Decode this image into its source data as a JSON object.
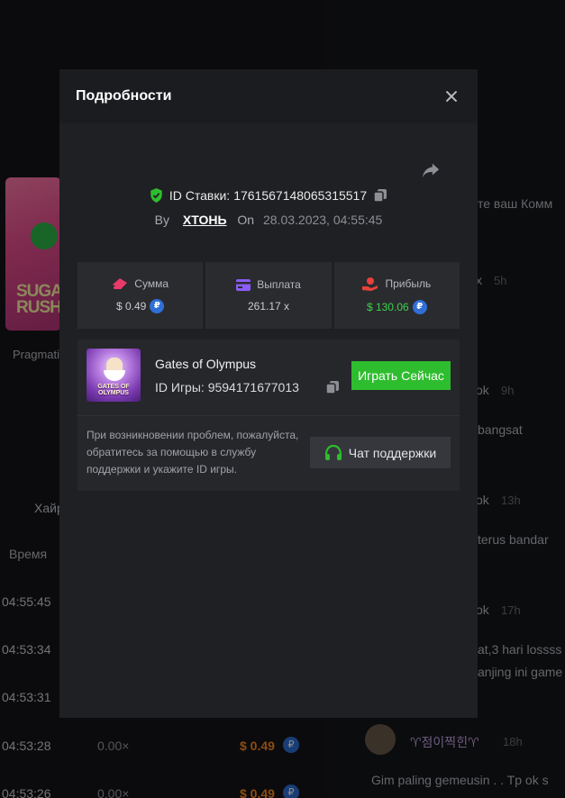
{
  "background": {
    "game_card_title": "SUGAR RUSH",
    "provider": "Pragmatic",
    "tab_label": "Хайроллеры",
    "time_header": "Время",
    "rows": [
      {
        "time": "04:55:45",
        "multiplier": "",
        "amount": ""
      },
      {
        "time": "04:53:34",
        "multiplier": "",
        "amount": ""
      },
      {
        "time": "04:53:31",
        "multiplier": "",
        "amount": ""
      },
      {
        "time": "04:53:28",
        "multiplier": "0.00×",
        "amount": "$ 0.49"
      },
      {
        "time": "04:53:26",
        "multiplier": "0.00×",
        "amount": "$ 0.49"
      }
    ],
    "chat": {
      "placeholder_fragment": "те ваш Комм",
      "messages": [
        {
          "user_fragment": "x",
          "time": "5h",
          "text": ""
        },
        {
          "user_fragment": "ok",
          "time": "9h",
          "text": "bangsat"
        },
        {
          "user_fragment": "ok",
          "time": "13h",
          "text": "terus bandar"
        },
        {
          "user_fragment": "ok",
          "time": "17h",
          "text": "at,3 hari lossss"
        },
        {
          "user_fragment": "",
          "time": "",
          "text": "anjing ini game"
        },
        {
          "user_fragment": "♈점이찍힌♈",
          "time": "18h",
          "text": "Gim paling gemeusin . . Tp ok s"
        }
      ]
    },
    "currency_symbol": "₽"
  },
  "modal": {
    "title": "Подробности",
    "bet_id_label": "ID Ставки:",
    "bet_id": "1761567148065315517",
    "by_label": "By",
    "username": "ХТОНЬ",
    "on_label": "On",
    "date": "28.03.2023, 04:55:45",
    "stats": {
      "amount_label": "Сумма",
      "amount_value": "$ 0.49",
      "payout_label": "Выплата",
      "payout_value": "261.17 x",
      "profit_label": "Прибыль",
      "profit_value": "$ 130.06"
    },
    "currency_symbol": "₽",
    "game": {
      "name": "Gates of Olympus",
      "thumb_text": "GATES OF OLYMPUS",
      "id_label": "ID Игры:",
      "id": "9594171677013",
      "play_button": "Играть Сейчас"
    },
    "help_text": "При возникновении проблем, пожалуйста, обратитесь за помощью в службу поддержки и укажите ID игры.",
    "support_button": "Чат поддержки"
  },
  "colors": {
    "accent_green": "#2ebd2e",
    "profit_green": "#3bd34a",
    "amount_orange": "#ff8a1f",
    "ruble_blue": "#2f6fd6",
    "modal_bg": "#1f2023"
  }
}
